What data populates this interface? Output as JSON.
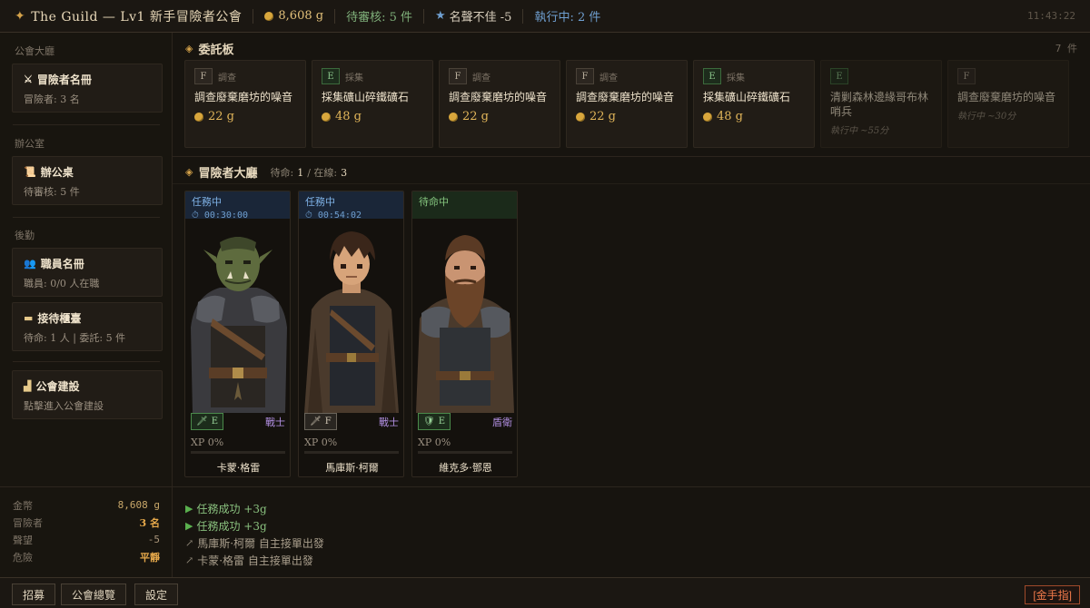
{
  "topbar": {
    "title": "The Guild — Lv1 新手冒險者公會",
    "gold": "8,608 g",
    "pending": "待審核: 5 件",
    "reputation": "名聲不佳 -5",
    "running": "執行中: 2 件",
    "clock": "11:43:22"
  },
  "sidebar": {
    "sections": {
      "hall": "公會大廳",
      "office": "辦公室",
      "logistics": "後勤"
    },
    "cards": {
      "roster": {
        "title": "冒險者名冊",
        "sub": "冒險者: 3 名",
        "icon": "crossed-swords-icon"
      },
      "desk": {
        "title": "辦公桌",
        "sub": "待審核: 5 件",
        "icon": "scroll-icon"
      },
      "staff": {
        "title": "職員名冊",
        "sub": "職員: 0/0 人在職",
        "icon": "people-icon"
      },
      "reception": {
        "title": "接待櫃臺",
        "sub": "待命: 1 人 | 委託: 5 件",
        "icon": "counter-icon"
      },
      "construction": {
        "title": "公會建設",
        "sub": "點擊進入公會建設",
        "icon": "building-icon"
      }
    },
    "stats": {
      "gold_label": "金幣",
      "gold_value": "8,608 g",
      "adventurers_label": "冒險者",
      "adventurers_value": "3 名",
      "reputation_label": "聲望",
      "reputation_value": "-5",
      "danger_label": "危險",
      "danger_value": "平靜"
    }
  },
  "board": {
    "title": "委託板",
    "count": "7 件",
    "quests": [
      {
        "rank": "F",
        "category": "調查",
        "name": "調查廢棄磨坊的噪音",
        "reward": "22 g",
        "running": ""
      },
      {
        "rank": "E",
        "category": "採集",
        "name": "採集礦山碎鐵礦石",
        "reward": "48 g",
        "running": ""
      },
      {
        "rank": "F",
        "category": "調查",
        "name": "調查廢棄磨坊的噪音",
        "reward": "22 g",
        "running": ""
      },
      {
        "rank": "F",
        "category": "調查",
        "name": "調查廢棄磨坊的噪音",
        "reward": "22 g",
        "running": ""
      },
      {
        "rank": "E",
        "category": "採集",
        "name": "採集礦山碎鐵礦石",
        "reward": "48 g",
        "running": ""
      },
      {
        "rank": "E",
        "category": "",
        "name": "清剿森林邊緣哥布林哨兵",
        "reward": "",
        "running": "執行中 ~55分"
      },
      {
        "rank": "F",
        "category": "",
        "name": "調查廢棄磨坊的噪音",
        "reward": "",
        "running": "執行中 ~30分"
      }
    ]
  },
  "hall": {
    "title": "冒險者大廳",
    "waiting_label": "待命:",
    "waiting_value": "1",
    "online_label": "/ 在線:",
    "online_value": "3",
    "adventurers": [
      {
        "status": "任務中",
        "timer": "⏱ 00:30:00",
        "rank": "E",
        "class": "戰士",
        "xp": "XP 0%",
        "xp_fraction": 0.0,
        "name": "卡蒙·格雷",
        "portrait": "orc-warrior"
      },
      {
        "status": "任務中",
        "timer": "⏱ 00:54:02",
        "rank": "F",
        "class": "戰士",
        "xp": "XP 0%",
        "xp_fraction": 0.0,
        "name": "馬庫斯·柯爾",
        "portrait": "young-fighter"
      },
      {
        "status": "待命中",
        "timer": "",
        "rank": "E",
        "class": "盾衛",
        "xp": "XP 0%",
        "xp_fraction": 0.0,
        "name": "維克多·鄧恩",
        "portrait": "dwarf-shieldguard"
      }
    ]
  },
  "log": [
    {
      "kind": "ok",
      "text": "任務成功 +3g"
    },
    {
      "kind": "ok",
      "text": "任務成功 +3g"
    },
    {
      "kind": "depart",
      "text": "馬庫斯·柯爾 自主接單出發"
    },
    {
      "kind": "depart",
      "text": "卡蒙·格雷 自主接單出發"
    }
  ],
  "bottombar": {
    "recruit": "招募",
    "overview": "公會總覽",
    "settings": "設定",
    "cheat": "[金手指]"
  },
  "colors": {
    "accent_gold": "#d4a24a",
    "busy_blue": "#7fb2e6",
    "idle_green": "#84c47e",
    "class_purple": "#b08ee0",
    "cheat_red": "#f07a4a"
  }
}
